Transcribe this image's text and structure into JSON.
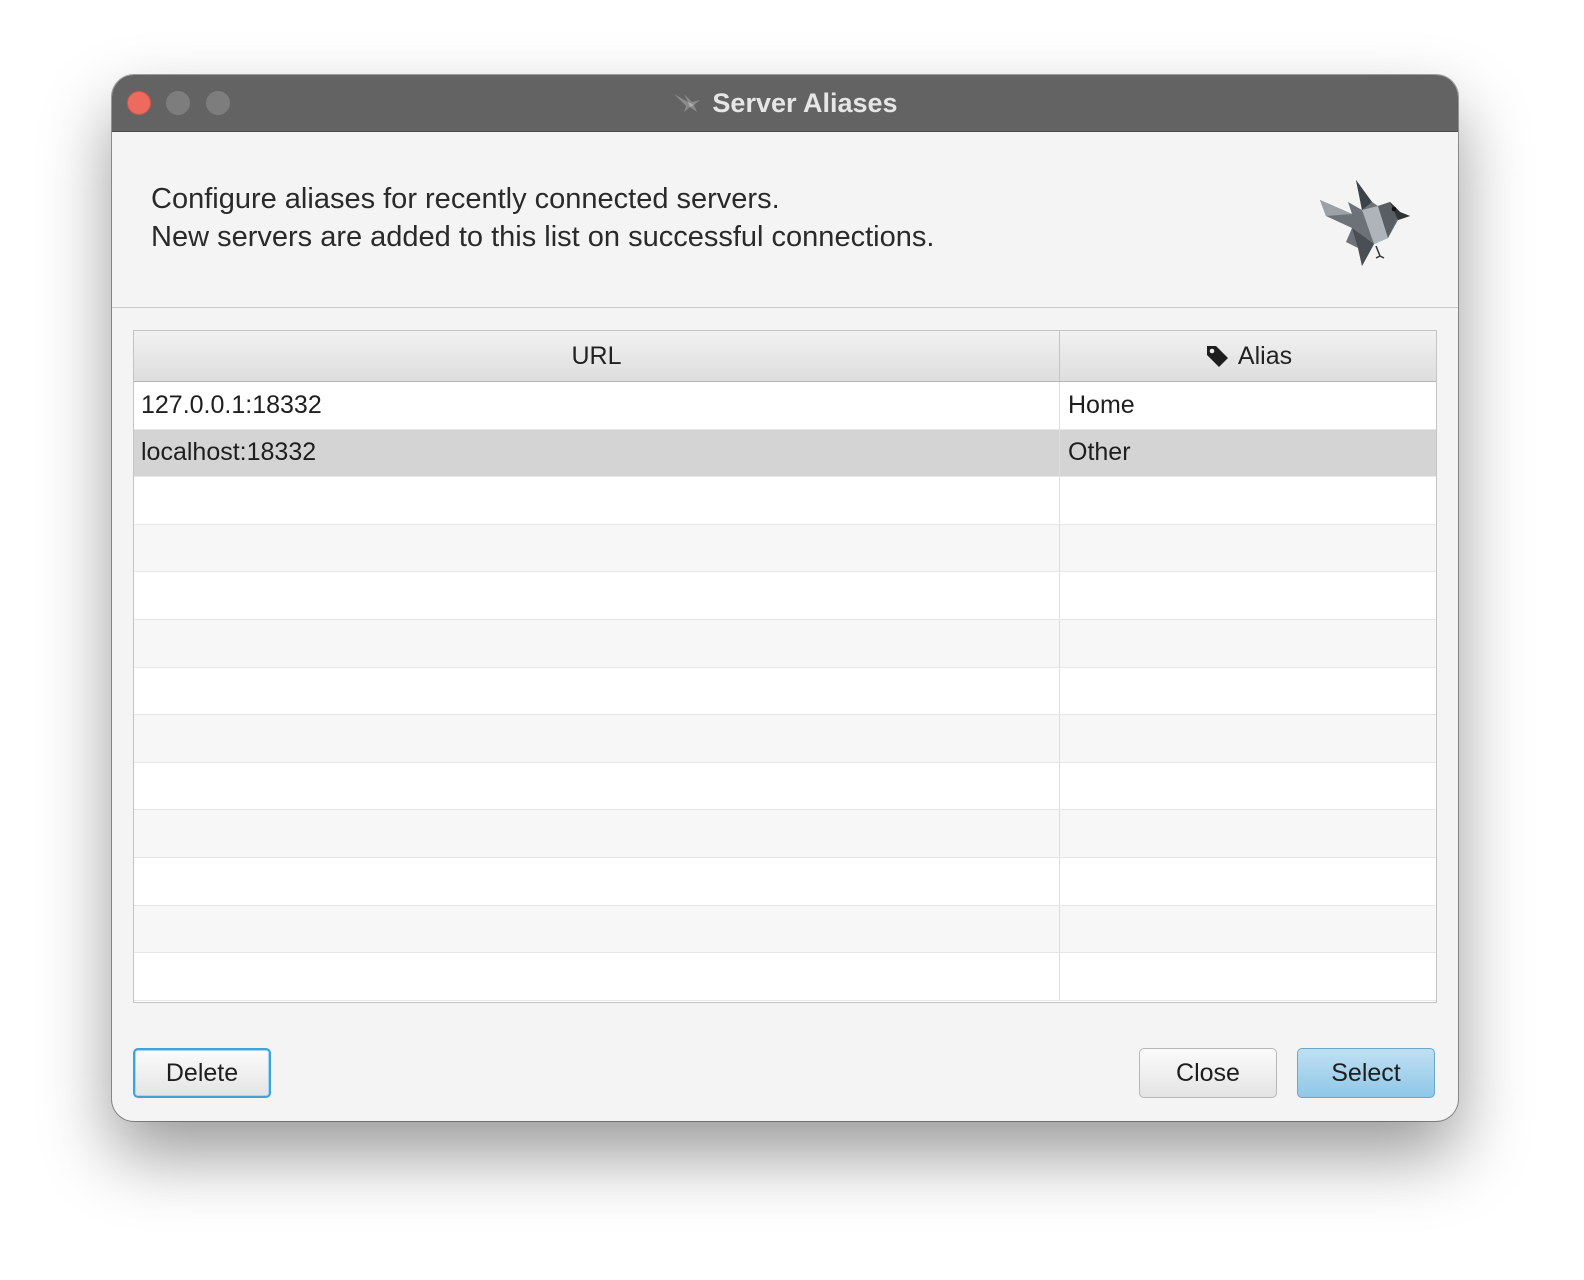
{
  "window": {
    "title": "Server Aliases"
  },
  "header": {
    "line1": "Configure aliases for recently connected servers.",
    "line2": "New servers are added to this list on successful connections.",
    "logo_icon": "sparrow-bird-logo"
  },
  "table": {
    "columns": {
      "url": "URL",
      "alias": "Alias",
      "alias_icon": "tag-icon"
    },
    "rows": [
      {
        "url": "127.0.0.1:18332",
        "alias": "Home"
      },
      {
        "url": "localhost:18332",
        "alias": "Other"
      },
      {
        "url": "",
        "alias": ""
      },
      {
        "url": "",
        "alias": ""
      },
      {
        "url": "",
        "alias": ""
      },
      {
        "url": "",
        "alias": ""
      },
      {
        "url": "",
        "alias": ""
      },
      {
        "url": "",
        "alias": ""
      },
      {
        "url": "",
        "alias": ""
      },
      {
        "url": "",
        "alias": ""
      },
      {
        "url": "",
        "alias": ""
      },
      {
        "url": "",
        "alias": ""
      },
      {
        "url": "",
        "alias": ""
      }
    ],
    "selected_row": 1
  },
  "buttons": {
    "delete": "Delete",
    "close": "Close",
    "select": "Select"
  },
  "colors": {
    "close_dot": "#ed6a5e",
    "titlebar": "#636363",
    "focus_ring": "#38a5de",
    "default_button": "#a8d3ee"
  }
}
